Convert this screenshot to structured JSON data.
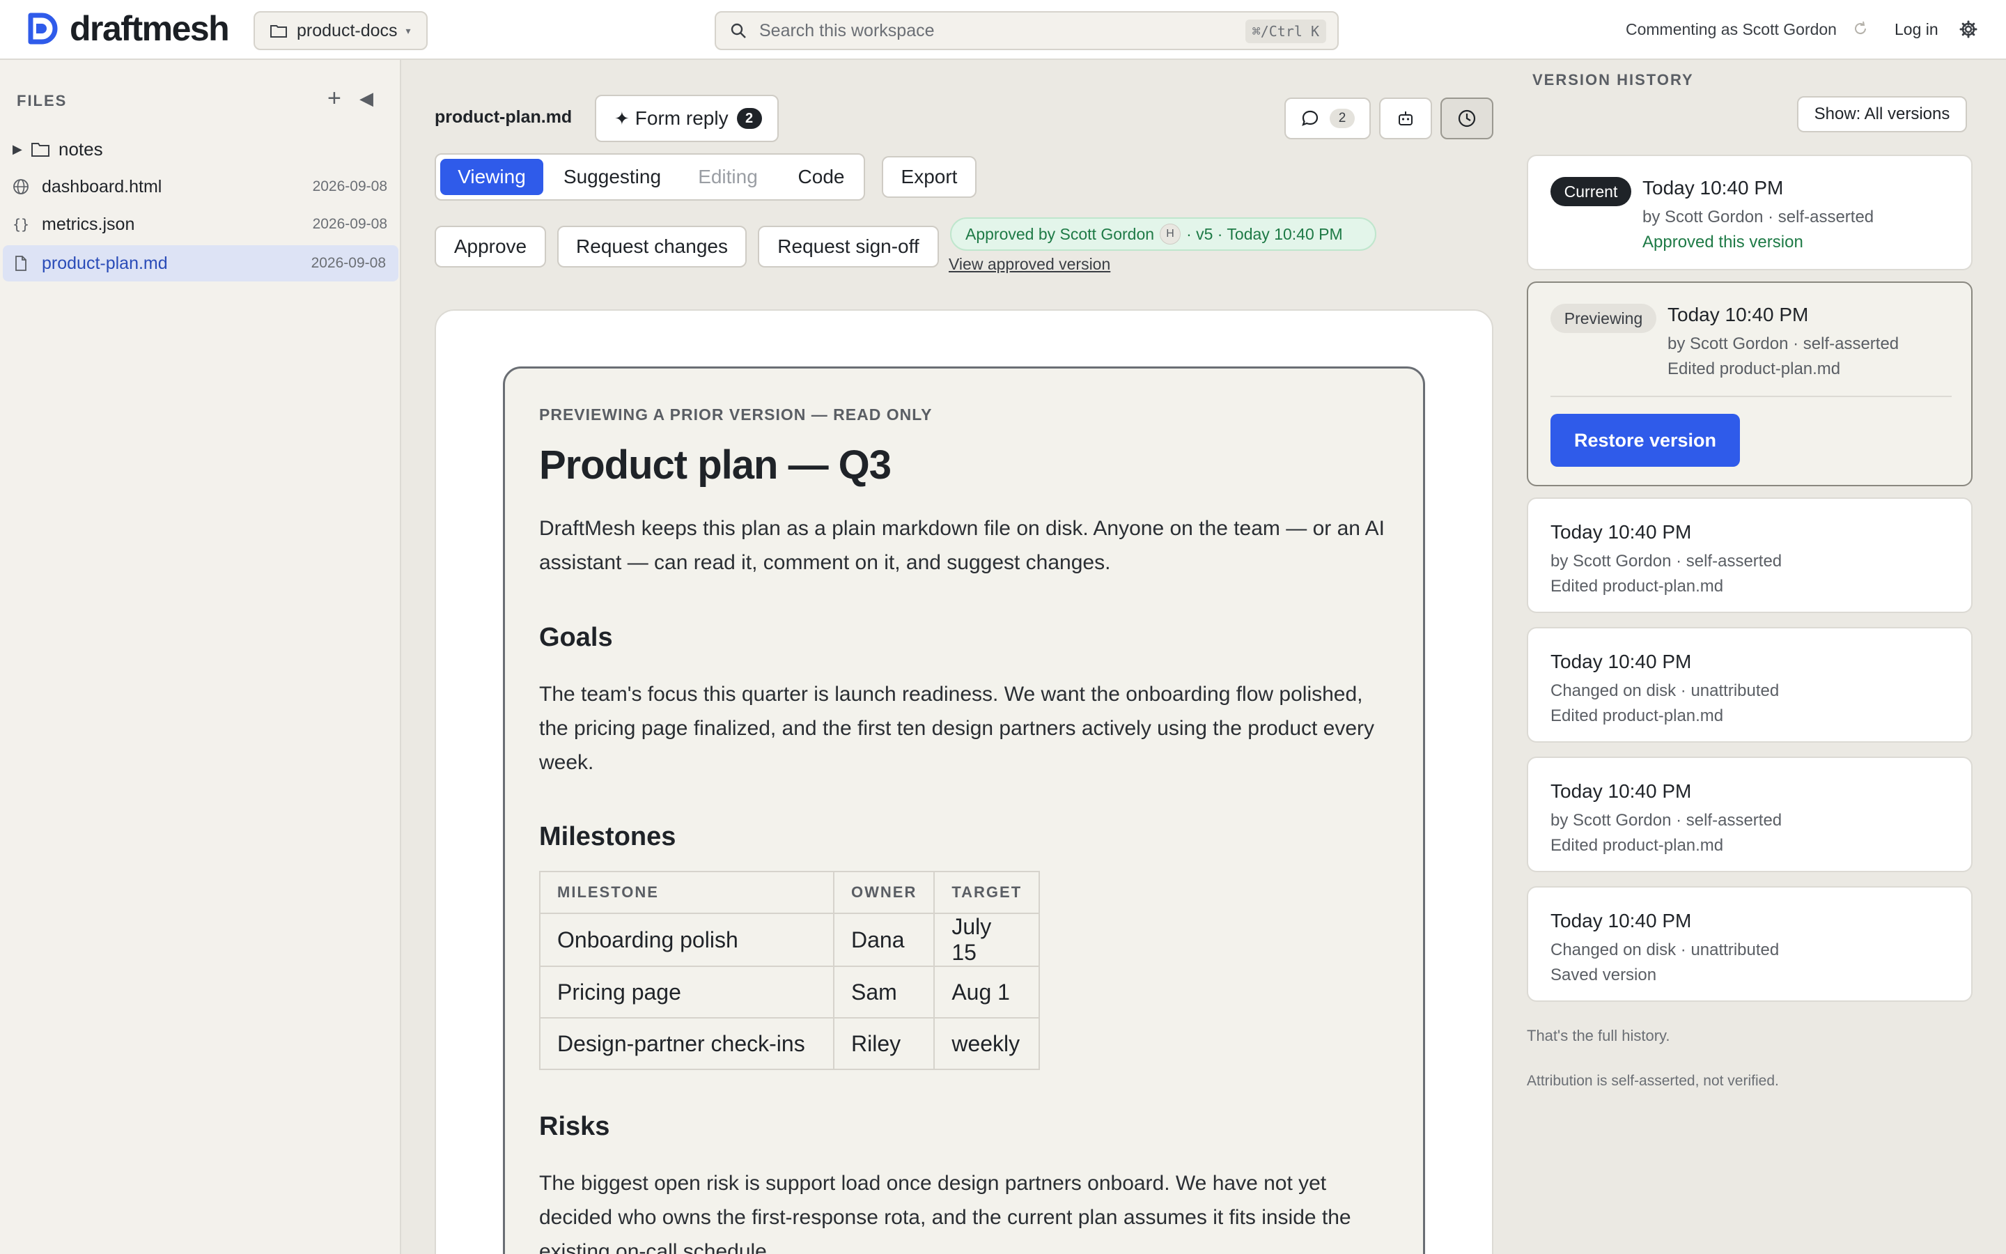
{
  "header": {
    "logo_text": "draftmesh",
    "workspace": "product-docs",
    "search_placeholder": "Search this workspace",
    "search_shortcut": "⌘/Ctrl K",
    "commenting_as": "Commenting as Scott Gordon",
    "login_label": "Log in"
  },
  "sidebar": {
    "title": "FILES",
    "items": [
      {
        "name": "notes",
        "type": "folder",
        "date": ""
      },
      {
        "name": "dashboard.html",
        "type": "file",
        "icon": "globe-icon",
        "date": "2026-09-08"
      },
      {
        "name": "metrics.json",
        "type": "file",
        "icon": "braces-icon",
        "date": "2026-09-08"
      },
      {
        "name": "product-plan.md",
        "type": "file",
        "icon": "file-icon",
        "date": "2026-09-08",
        "active": true
      }
    ]
  },
  "toolbar": {
    "file_name": "product-plan.md",
    "form_reply_label": "Form reply",
    "form_reply_count": "2",
    "comments_count": "2",
    "modes": {
      "viewing": "Viewing",
      "suggesting": "Suggesting",
      "editing": "Editing",
      "code": "Code"
    },
    "export_label": "Export",
    "approve_label": "Approve",
    "request_changes_label": "Request changes",
    "request_signoff_label": "Request sign-off",
    "approved_by": "Approved by Scott Gordon",
    "approved_avatar": "H",
    "approved_meta": "· v5 · Today 10:40 PM",
    "view_approved_link": "View approved version"
  },
  "document": {
    "preview_label": "PREVIEWING A PRIOR VERSION — READ ONLY",
    "title": "Product plan — Q3",
    "intro": "DraftMesh keeps this plan as a plain markdown file on disk. Anyone on the team — or an AI assistant — can read it, comment on it, and suggest changes.",
    "goals_heading": "Goals",
    "goals_text": "The team's focus this quarter is launch readiness. We want the onboarding flow polished, the pricing page finalized, and the first ten design partners actively using the product every week.",
    "milestones_heading": "Milestones",
    "milestones_table": {
      "headers": [
        "MILESTONE",
        "OWNER",
        "TARGET"
      ],
      "rows": [
        [
          "Onboarding polish",
          "Dana",
          "July 15"
        ],
        [
          "Pricing page",
          "Sam",
          "Aug 1"
        ],
        [
          "Design-partner check-ins",
          "Riley",
          "weekly"
        ]
      ]
    },
    "risks_heading": "Risks",
    "risks_text": "The biggest open risk is support load once design partners onboard. We have not yet decided who owns the first-response rota, and the current plan assumes it fits inside the existing on-call schedule."
  },
  "version_history": {
    "title": "VERSION HISTORY",
    "show_label": "Show: All versions",
    "restore_label": "Restore version",
    "versions": [
      {
        "badge": "Current",
        "time": "Today 10:40 PM",
        "by": "by Scott Gordon · self-asserted",
        "note": "Approved this version"
      },
      {
        "badge": "Previewing",
        "time": "Today 10:40 PM",
        "by": "by Scott Gordon · self-asserted",
        "note": "Edited product-plan.md"
      },
      {
        "badge": "",
        "time": "Today 10:40 PM",
        "by": "by Scott Gordon · self-asserted",
        "note": "Edited product-plan.md"
      },
      {
        "badge": "",
        "time": "Today 10:40 PM",
        "by": "Changed on disk · unattributed",
        "note": "Edited product-plan.md"
      },
      {
        "badge": "",
        "time": "Today 10:40 PM",
        "by": "by Scott Gordon · self-asserted",
        "note": "Edited product-plan.md"
      },
      {
        "badge": "",
        "time": "Today 10:40 PM",
        "by": "Changed on disk · unattributed",
        "note": "Saved version"
      }
    ],
    "footer_full": "That's the full history.",
    "footer_attribution": "Attribution is self-asserted, not verified."
  },
  "colors": {
    "accent": "#2f5bea",
    "approved_green": "#1e7a46",
    "background": "#ebe9e3"
  }
}
